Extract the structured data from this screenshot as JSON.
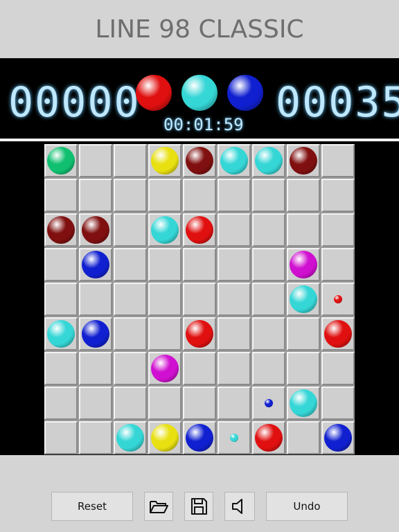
{
  "title": "LINE 98 CLASSIC",
  "score_left": "00000",
  "score_right": "00035",
  "timer": "00:01:59",
  "colors": {
    "red": "#e01010",
    "cyan": "#35d6d6",
    "blue": "#1020d0",
    "green": "#10c070",
    "yellow": "#e8e010",
    "maroon": "#801010",
    "magenta": "#d010d0"
  },
  "next_balls": [
    "red",
    "cyan",
    "blue"
  ],
  "board": [
    [
      [
        "green",
        "big"
      ],
      null,
      null,
      [
        "yellow",
        "big"
      ],
      [
        "maroon",
        "big"
      ],
      [
        "cyan",
        "big"
      ],
      [
        "cyan",
        "big"
      ],
      [
        "maroon",
        "big"
      ],
      null
    ],
    [
      null,
      null,
      null,
      null,
      null,
      null,
      null,
      null,
      null
    ],
    [
      [
        "maroon",
        "big"
      ],
      [
        "maroon",
        "big"
      ],
      null,
      [
        "cyan",
        "big"
      ],
      [
        "red",
        "big"
      ],
      null,
      null,
      null,
      null
    ],
    [
      null,
      [
        "blue",
        "big"
      ],
      null,
      null,
      null,
      null,
      null,
      [
        "magenta",
        "big"
      ],
      null
    ],
    [
      null,
      null,
      null,
      null,
      null,
      null,
      null,
      [
        "cyan",
        "big"
      ],
      [
        "red",
        "small"
      ]
    ],
    [
      [
        "cyan",
        "big"
      ],
      [
        "blue",
        "big"
      ],
      null,
      null,
      [
        "red",
        "big"
      ],
      null,
      null,
      null,
      [
        "red",
        "big"
      ]
    ],
    [
      null,
      null,
      null,
      [
        "magenta",
        "big"
      ],
      null,
      null,
      null,
      null,
      null
    ],
    [
      null,
      null,
      null,
      null,
      null,
      null,
      [
        "blue",
        "small"
      ],
      [
        "cyan",
        "big"
      ],
      null
    ],
    [
      null,
      null,
      [
        "cyan",
        "big"
      ],
      [
        "yellow",
        "big"
      ],
      [
        "blue",
        "big"
      ],
      [
        "cyan",
        "small"
      ],
      [
        "red",
        "big"
      ],
      null,
      [
        "blue",
        "big"
      ]
    ]
  ],
  "buttons": {
    "reset": "Reset",
    "undo": "Undo",
    "open_icon": "folder-open-icon",
    "save_icon": "floppy-disk-icon",
    "sound_icon": "speaker-icon"
  }
}
